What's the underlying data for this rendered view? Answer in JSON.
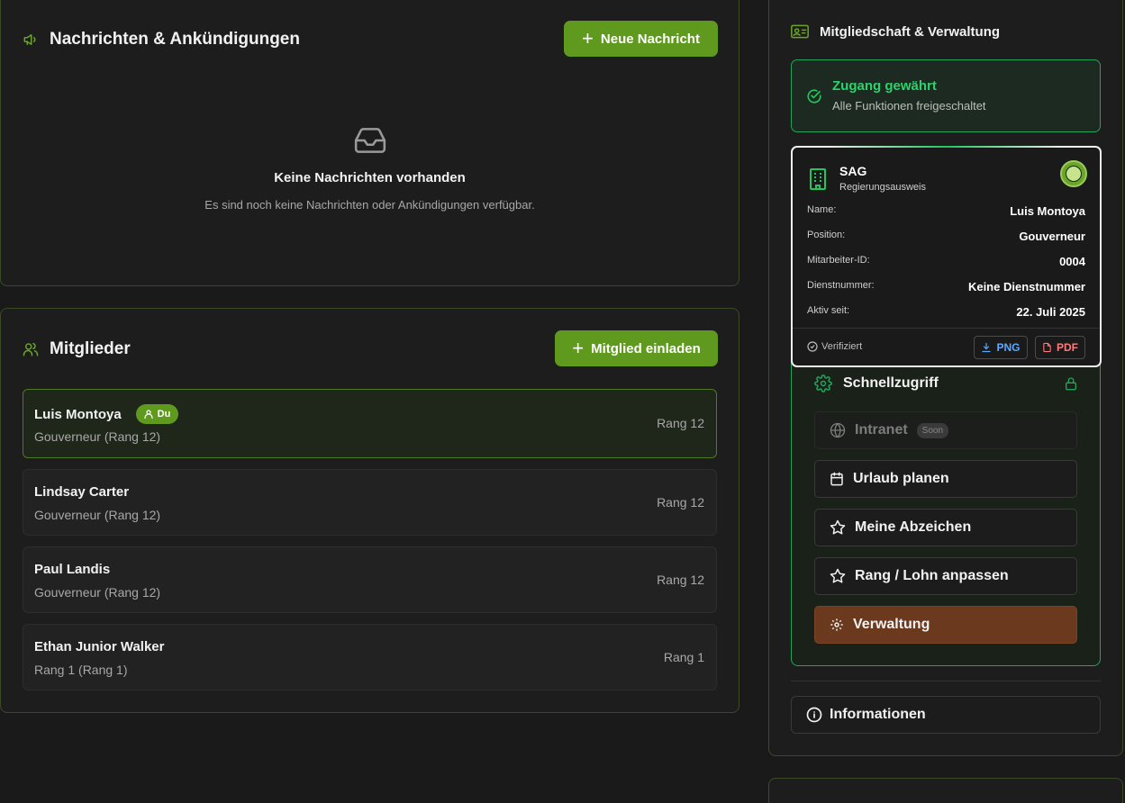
{
  "messages": {
    "title": "Nachrichten & Ankündigungen",
    "new_button": "Neue Nachricht",
    "empty_title": "Keine Nachrichten vorhanden",
    "empty_sub": "Es sind noch keine Nachrichten oder Ankündigungen verfügbar."
  },
  "members": {
    "title": "Mitglieder",
    "invite_button": "Mitglied einladen",
    "you_badge": "Du",
    "list": [
      {
        "name": "Luis Montoya",
        "role": "Gouverneur (Rang 12)",
        "rank": "Rang 12"
      },
      {
        "name": "Lindsay Carter",
        "role": "Gouverneur (Rang 12)",
        "rank": "Rang 12"
      },
      {
        "name": "Paul Landis",
        "role": "Gouverneur (Rang 12)",
        "rank": "Rang 12"
      },
      {
        "name": "Ethan Junior Walker",
        "role": "Rang 1 (Rang 1)",
        "rank": "Rang 1"
      }
    ]
  },
  "membership": {
    "title": "Mitgliedschaft & Verwaltung",
    "access_title": "Zugang gewährt",
    "access_sub": "Alle Funktionen freigeschaltet"
  },
  "idcard": {
    "org": "SAG",
    "type": "Regierungsausweis",
    "fields": [
      {
        "label": "Name:",
        "value": "Luis Montoya"
      },
      {
        "label": "Position:",
        "value": "Gouverneur"
      },
      {
        "label": "Mitarbeiter-ID:",
        "value": "0004"
      },
      {
        "label": "Dienstnummer:",
        "value": "Keine Dienstnummer"
      },
      {
        "label": "Aktiv seit:",
        "value": "22. Juli 2025"
      }
    ],
    "verified": "Verifiziert",
    "png": "PNG",
    "pdf": "PDF"
  },
  "quick": {
    "title": "Schnellzugriff",
    "intranet": "Intranet",
    "soon": "Soon",
    "vacation": "Urlaub planen",
    "badges": "Meine Abzeichen",
    "rank_pay": "Rang / Lohn anpassen",
    "admin": "Verwaltung"
  },
  "info": {
    "label": "Informationen"
  },
  "colors": {
    "accent": "#5f9a1f",
    "success": "#22c55e",
    "admin": "#6b3a1e"
  }
}
